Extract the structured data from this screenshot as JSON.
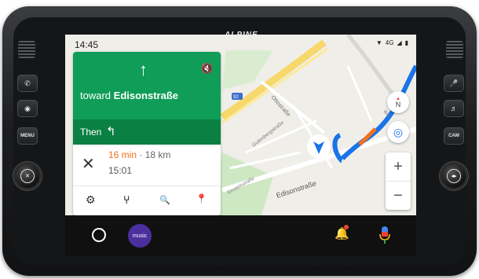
{
  "device": {
    "brand": "ALPINE",
    "left_buttons": [
      {
        "name": "phone-icon",
        "label": "✆"
      },
      {
        "name": "power-ring-icon",
        "label": "◉"
      },
      {
        "name": "menu-button",
        "label": "MENU"
      }
    ],
    "right_buttons": [
      {
        "name": "mic-icon",
        "label": "🎤"
      },
      {
        "name": "music-note-icon",
        "label": "♬"
      },
      {
        "name": "cam-button",
        "label": "CAM"
      }
    ]
  },
  "status": {
    "time": "14:45",
    "network": "4G"
  },
  "navigation": {
    "maneuver_icon": "arrow-up-icon",
    "mute_icon": "volume-off-icon",
    "toward_prefix": "toward",
    "street": "Edisonstraße",
    "then_label": "Then",
    "then_icon": "turn-left-icon",
    "eta_minutes": "16 min",
    "separator": "·",
    "distance": "18 km",
    "arrival_time": "15:01"
  },
  "nav_actions": [
    {
      "name": "settings-icon",
      "glyph": "⚙"
    },
    {
      "name": "route-options-icon",
      "glyph": "⑂"
    },
    {
      "name": "search-icon",
      "glyph": "🔍"
    },
    {
      "name": "place-pin-icon",
      "glyph": "📍"
    }
  ],
  "map": {
    "road_labels": [
      "92",
      "Ottostraße",
      "Edisonstraße",
      "Gutenbergstraße",
      "Einsteinstraße",
      "Wer"
    ],
    "compass_letter": "N",
    "zoom_in": "+",
    "zoom_out": "−"
  },
  "dock": {
    "music_app_label": "music",
    "colors": {
      "route": "#1a73e8",
      "nav_green": "#0f9d58",
      "eta_orange": "#f2711c"
    }
  }
}
